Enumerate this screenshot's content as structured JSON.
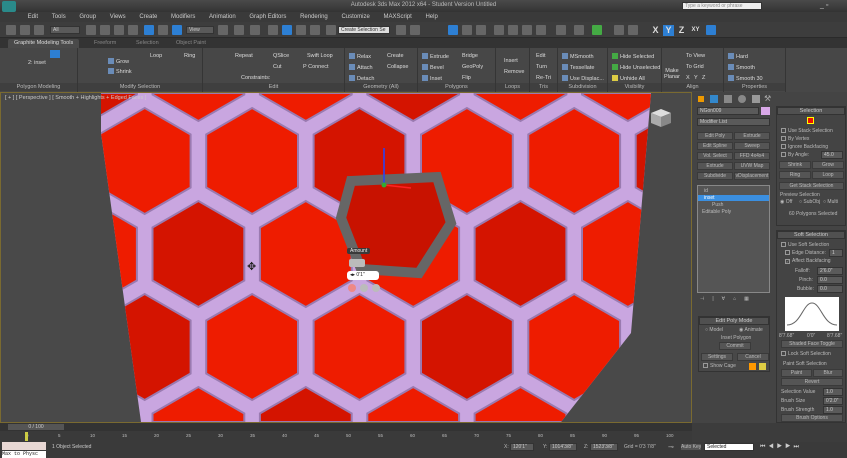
{
  "title": "Autodesk 3ds Max 2012 x64 - Student Version  Untitled",
  "search_placeholder": "Type a keyword or phrase",
  "menu": [
    "Edit",
    "Tools",
    "Group",
    "Views",
    "Create",
    "Modifiers",
    "Animation",
    "Graph Editors",
    "Rendering",
    "Customize",
    "MAXScript",
    "Help"
  ],
  "toolbar": {
    "filter": "All",
    "ref_coord": "View",
    "selection_set": "Create Selection Se",
    "axes": [
      "X",
      "Y",
      "Z",
      "XY"
    ]
  },
  "ribbon_tabs": [
    "Graphite Modeling Tools",
    "Freeform",
    "Selection",
    "Object Paint"
  ],
  "ribbon": {
    "polygon_modeling": {
      "label": "Polygon Modeling",
      "mode": "2: inset"
    },
    "modify_selection": {
      "label": "Modify Selection",
      "items": [
        "Grow",
        "Shrink",
        "Loop",
        "Ring"
      ]
    },
    "edit": {
      "label": "Edit",
      "items": [
        "Repeat",
        "QSlice",
        "Swift Loop",
        "Cut",
        "P Connect",
        "Constraints:"
      ]
    },
    "geometry": {
      "label": "Geometry (All)",
      "items": [
        "Relax",
        "Create",
        "Attach",
        "Collapse",
        "Detach"
      ]
    },
    "polygons": {
      "label": "Polygons",
      "items": [
        "Extrude",
        "Bridge",
        "Bevel",
        "GeoPoly",
        "Inset",
        "Flip"
      ]
    },
    "loops": {
      "label": "Loops",
      "items": [
        "Insert",
        "Remove"
      ]
    },
    "tris": {
      "label": "Tris",
      "items": [
        "Edit",
        "Turn",
        "Re-Tri"
      ]
    },
    "subdivision": {
      "label": "Subdivision",
      "items": [
        "MSmooth",
        "Tessellate",
        "Use Displac..."
      ]
    },
    "visibility": {
      "label": "Visibility",
      "items": [
        "Hide Selected",
        "Hide Unselected",
        "Unhide All"
      ]
    },
    "align": {
      "label": "Align",
      "items": [
        "Make Planar",
        "To View",
        "To Grid",
        "X",
        "Y",
        "Z"
      ]
    },
    "properties": {
      "label": "Properties",
      "items": [
        "Hard",
        "Smooth",
        "Smooth 30"
      ]
    }
  },
  "viewport": {
    "label": "[ + ] [ Perspective ] [ Smooth + Highlights + Edged Faces ]",
    "caddy_title": "Amount",
    "caddy_value": "0'1\""
  },
  "command_panel": {
    "object_name": "NGon009",
    "modifier_list": "Modifier List",
    "mod_buttons": [
      "Edit Poly",
      "Extrude",
      "Edit Spline",
      "Sweep",
      "Vol. Select",
      "FFD 4x4x4",
      "Extrude",
      "UVW Map",
      "Subdivide",
      "vDisplacement"
    ],
    "stack": [
      "id",
      "inset",
      "Push",
      "Editable Poly"
    ],
    "edit_poly_mode": {
      "header": "Edit Poly Mode",
      "model": "Model",
      "animate": "Animate",
      "op": "Inset Polygon",
      "commit": "Commit",
      "settings": "Settings",
      "cancel": "Cancel",
      "show_cage": "Show Cage"
    },
    "selection": {
      "header": "Selection",
      "use_stack": "Use Stack Selection",
      "by_vertex": "By Vertex",
      "ignore_backfacing": "Ignore Backfacing",
      "by_angle": "By Angle:",
      "angle_value": "45.0",
      "shrink": "Shrink",
      "grow": "Grow",
      "ring": "Ring",
      "loop": "Loop",
      "get_stack": "Get Stack Selection",
      "preview": "Preview Selection",
      "off": "Off",
      "subobj": "SubObj",
      "multi": "Multi",
      "status": "60 Polygons Selected"
    },
    "soft_selection": {
      "header": "Soft Selection",
      "use_soft": "Use Soft Selection",
      "edge_distance": "Edge Distance:",
      "edge_value": "1",
      "affect_backfacing": "Affect Backfacing",
      "falloff_label": "Falloff:",
      "falloff": "2'6.0\"",
      "pinch_label": "Pinch:",
      "pinch": "0.0",
      "bubble_label": "Bubble:",
      "bubble": "0.0",
      "curve_labels": [
        "8'7.68\"",
        "0'0\"",
        "8'7.68\""
      ],
      "shaded_face": "Shaded Face Toggle",
      "lock": "Lock Soft Selection",
      "paint_header": "Paint Soft Selection",
      "paint": "Paint",
      "blur": "Blur",
      "revert": "Revert",
      "sel_value": "Selection Value",
      "sel_value_v": "1.0",
      "brush_size": "Brush Size",
      "brush_size_v": "0'2.0\"",
      "brush_strength": "Brush Strength",
      "brush_strength_v": "1.0",
      "brush_options": "Brush Options"
    }
  },
  "timeslider": "0 / 100",
  "ticks": [
    "0",
    "5",
    "10",
    "15",
    "20",
    "25",
    "30",
    "35",
    "40",
    "45",
    "50",
    "55",
    "60",
    "65",
    "70",
    "75",
    "80",
    "85",
    "90",
    "95",
    "100"
  ],
  "status": {
    "message": "1 Object Selected",
    "prompt": "Max to Physc",
    "x_label": "X:",
    "x": "120'1\"",
    "y_label": "Y:",
    "y": "1014'3/8\"",
    "z_label": "Z:",
    "z": "1523'3/8\"",
    "grid": "Grid = 0'3 7/8\"",
    "auto_key": "Auto Key",
    "key_filter": "Selected"
  },
  "colors": {
    "face": "#ee1c00",
    "edge": "#c9a6e0",
    "accent": "#2d7fd3"
  }
}
